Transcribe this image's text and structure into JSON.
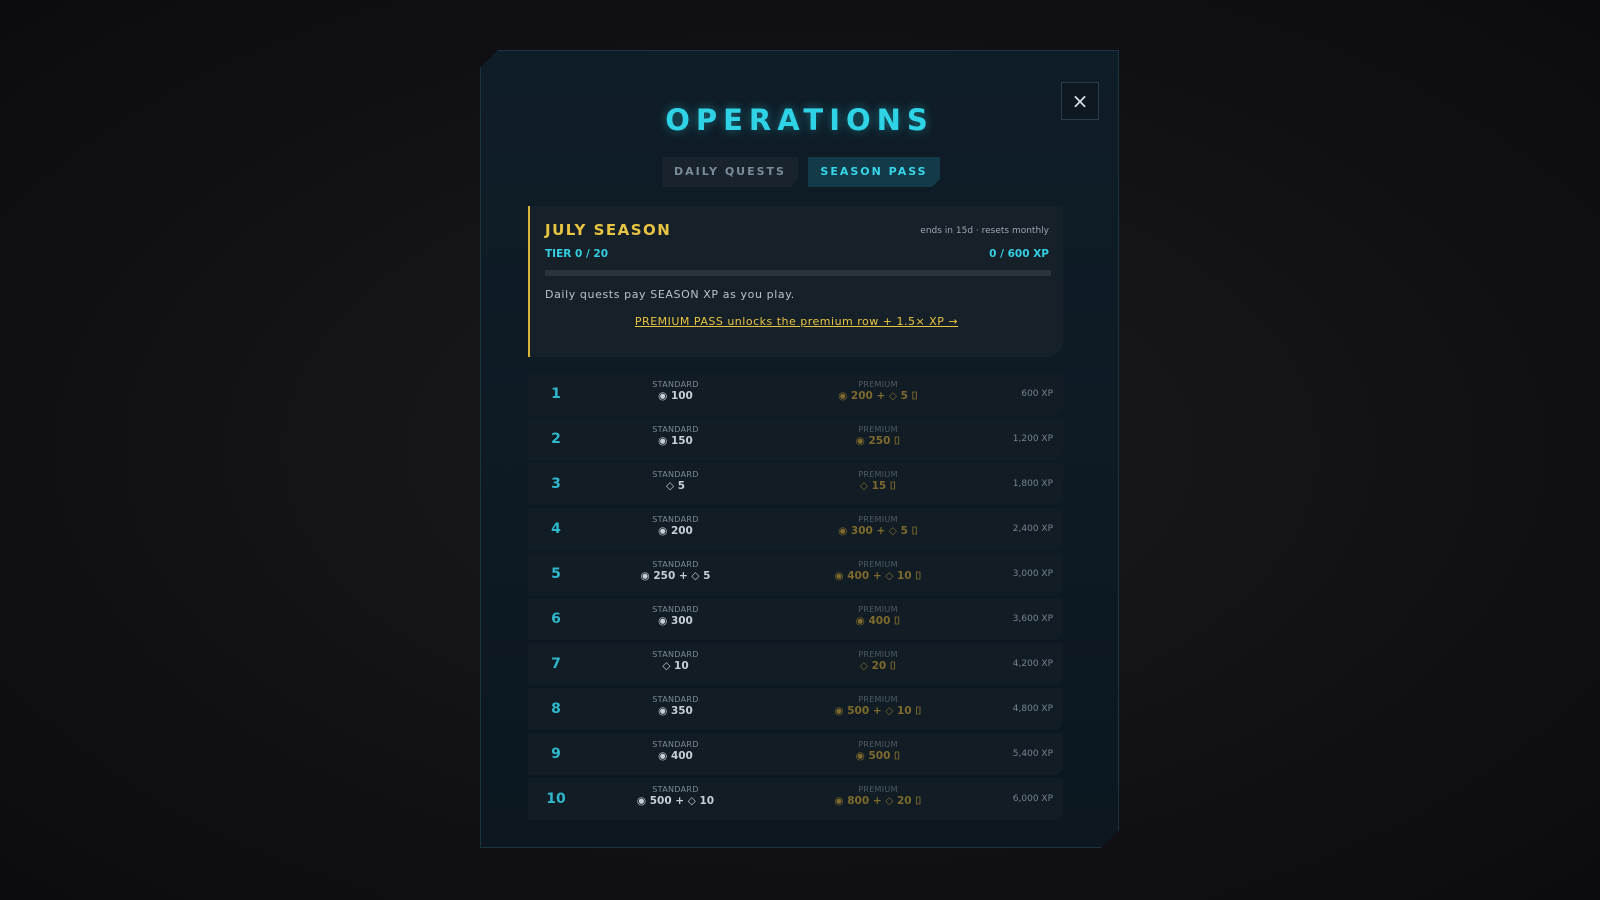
{
  "modal": {
    "title": "OPERATIONS",
    "close_icon": "×"
  },
  "tabs": [
    {
      "label": "DAILY QUESTS",
      "active": false
    },
    {
      "label": "SEASON PASS",
      "active": true
    }
  ],
  "season": {
    "title": "JULY SEASON",
    "meta": "ends in 15d · resets monthly",
    "tier_label": "TIER 0 / 20",
    "xp_label": "0 / 600 XP",
    "progress": 0,
    "description": "Daily quests pay SEASON XP as you play.",
    "premium_link": "PREMIUM PASS unlocks the premium row + 1.5× XP →"
  },
  "colors": {
    "accent": "#2fd3e6",
    "gold": "#e8c443",
    "premium_dim": "#7e6a2c"
  },
  "tiers": [
    {
      "num": "1",
      "standard_label": "STANDARD",
      "standard": "◉ 100",
      "premium_label": "PREMIUM",
      "premium": "◉ 200 + ◇ 5 ⌷",
      "xp": "600 XP"
    },
    {
      "num": "2",
      "standard_label": "STANDARD",
      "standard": "◉ 150",
      "premium_label": "PREMIUM",
      "premium": "◉ 250 ⌷",
      "xp": "1,200 XP"
    },
    {
      "num": "3",
      "standard_label": "STANDARD",
      "standard": "◇ 5",
      "premium_label": "PREMIUM",
      "premium": "◇ 15 ⌷",
      "xp": "1,800 XP"
    },
    {
      "num": "4",
      "standard_label": "STANDARD",
      "standard": "◉ 200",
      "premium_label": "PREMIUM",
      "premium": "◉ 300 + ◇ 5 ⌷",
      "xp": "2,400 XP"
    },
    {
      "num": "5",
      "standard_label": "STANDARD",
      "standard": "◉ 250 + ◇ 5",
      "premium_label": "PREMIUM",
      "premium": "◉ 400 + ◇ 10 ⌷",
      "xp": "3,000 XP"
    },
    {
      "num": "6",
      "standard_label": "STANDARD",
      "standard": "◉ 300",
      "premium_label": "PREMIUM",
      "premium": "◉ 400 ⌷",
      "xp": "3,600 XP"
    },
    {
      "num": "7",
      "standard_label": "STANDARD",
      "standard": "◇ 10",
      "premium_label": "PREMIUM",
      "premium": "◇ 20 ⌷",
      "xp": "4,200 XP"
    },
    {
      "num": "8",
      "standard_label": "STANDARD",
      "standard": "◉ 350",
      "premium_label": "PREMIUM",
      "premium": "◉ 500 + ◇ 10 ⌷",
      "xp": "4,800 XP"
    },
    {
      "num": "9",
      "standard_label": "STANDARD",
      "standard": "◉ 400",
      "premium_label": "PREMIUM",
      "premium": "◉ 500 ⌷",
      "xp": "5,400 XP"
    },
    {
      "num": "10",
      "standard_label": "STANDARD",
      "standard": "◉ 500 + ◇ 10",
      "premium_label": "PREMIUM",
      "premium": "◉ 800 + ◇ 20 ⌷",
      "xp": "6,000 XP"
    }
  ]
}
